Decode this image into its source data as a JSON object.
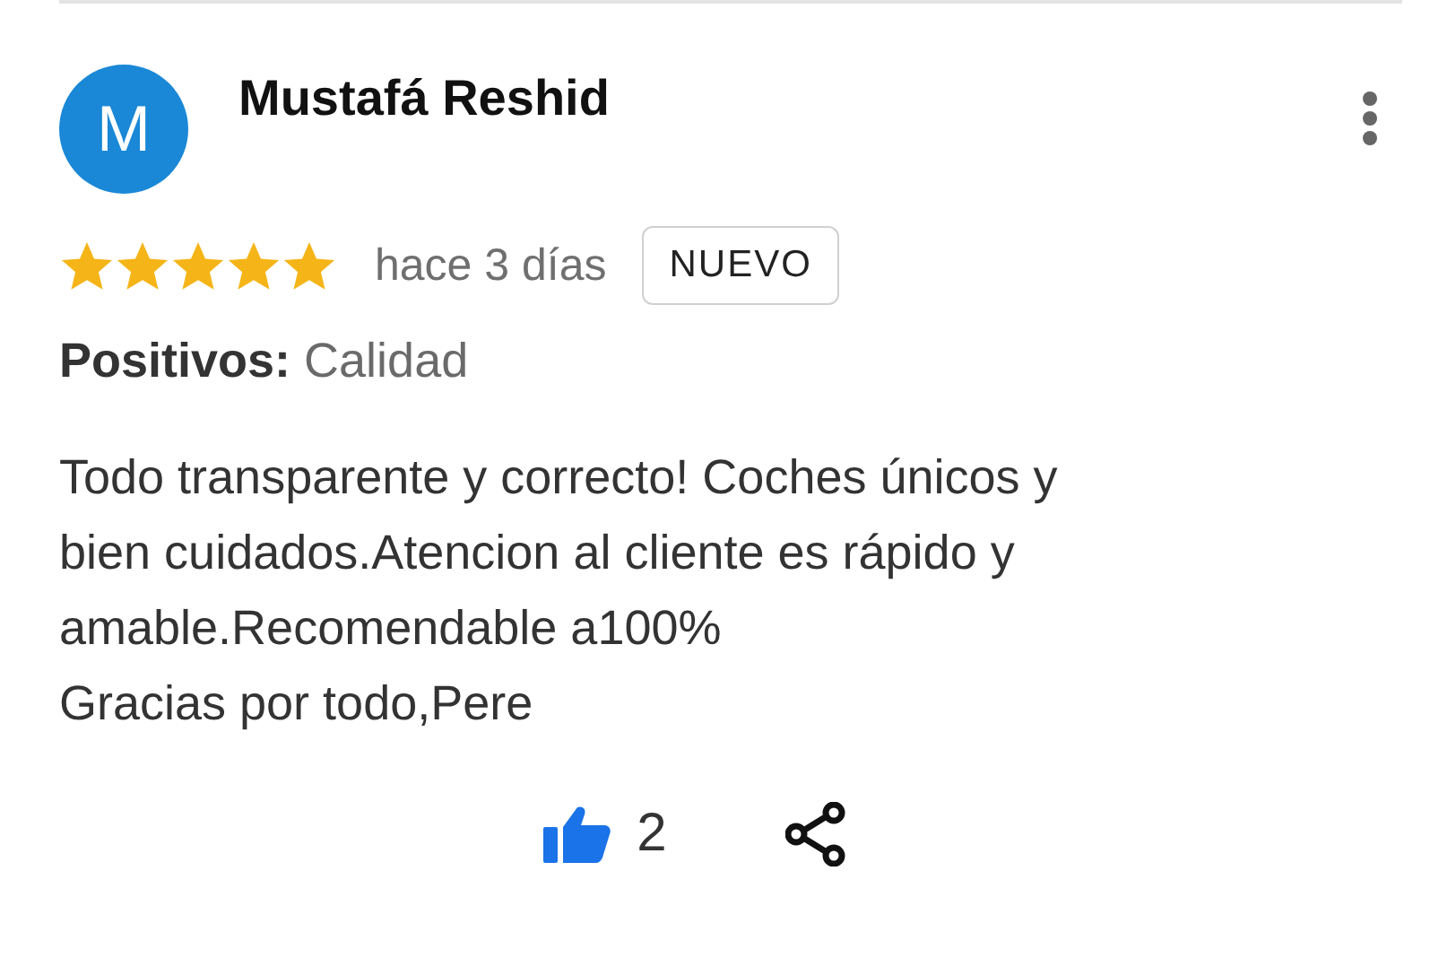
{
  "review": {
    "avatar_letter": "M",
    "author": "Mustafá Reshid",
    "stars": 5,
    "time": "hace 3 días",
    "badge": "NUEVO",
    "highlight_label": "Positivos:",
    "highlight_value": "Calidad",
    "text_lines": [
      "Todo transparente y correcto! Coches únicos y",
      "bien cuidados.Atencion al cliente es rápido y",
      "amable.Recomendable a100%",
      "Gracias por todo,Pere"
    ],
    "likes": "2"
  }
}
